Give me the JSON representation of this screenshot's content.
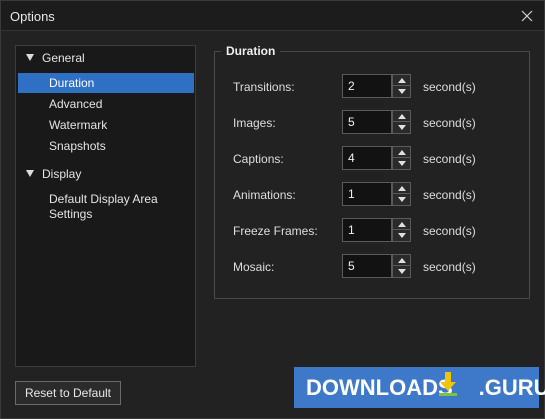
{
  "window": {
    "title": "Options"
  },
  "nav": {
    "categories": [
      {
        "label": "General",
        "items": [
          "Duration",
          "Advanced",
          "Watermark",
          "Snapshots"
        ]
      },
      {
        "label": "Display",
        "items": [
          [
            "Default Display Area",
            "Settings"
          ]
        ]
      }
    ],
    "selected": "Duration"
  },
  "duration": {
    "title": "Duration",
    "unit": "second(s)",
    "rows": [
      {
        "label": "Transitions:",
        "value": "2"
      },
      {
        "label": "Images:",
        "value": "5"
      },
      {
        "label": "Captions:",
        "value": "4"
      },
      {
        "label": "Animations:",
        "value": "1"
      },
      {
        "label": "Freeze Frames:",
        "value": "1"
      },
      {
        "label": "Mosaic:",
        "value": "5"
      }
    ]
  },
  "buttons": {
    "reset": "Reset to Default"
  },
  "watermark": {
    "text_left": "DOWNLOADS",
    "text_right": ".GURU"
  },
  "colors": {
    "selection": "#2f6fc4",
    "background": "#222222",
    "watermark": "#3d78c9",
    "watermark_icon": "#f2c400"
  },
  "icons": {
    "close": "close-icon",
    "expand": "triangle-down-icon",
    "spin_up": "arrow-up-icon",
    "spin_down": "arrow-down-icon"
  }
}
